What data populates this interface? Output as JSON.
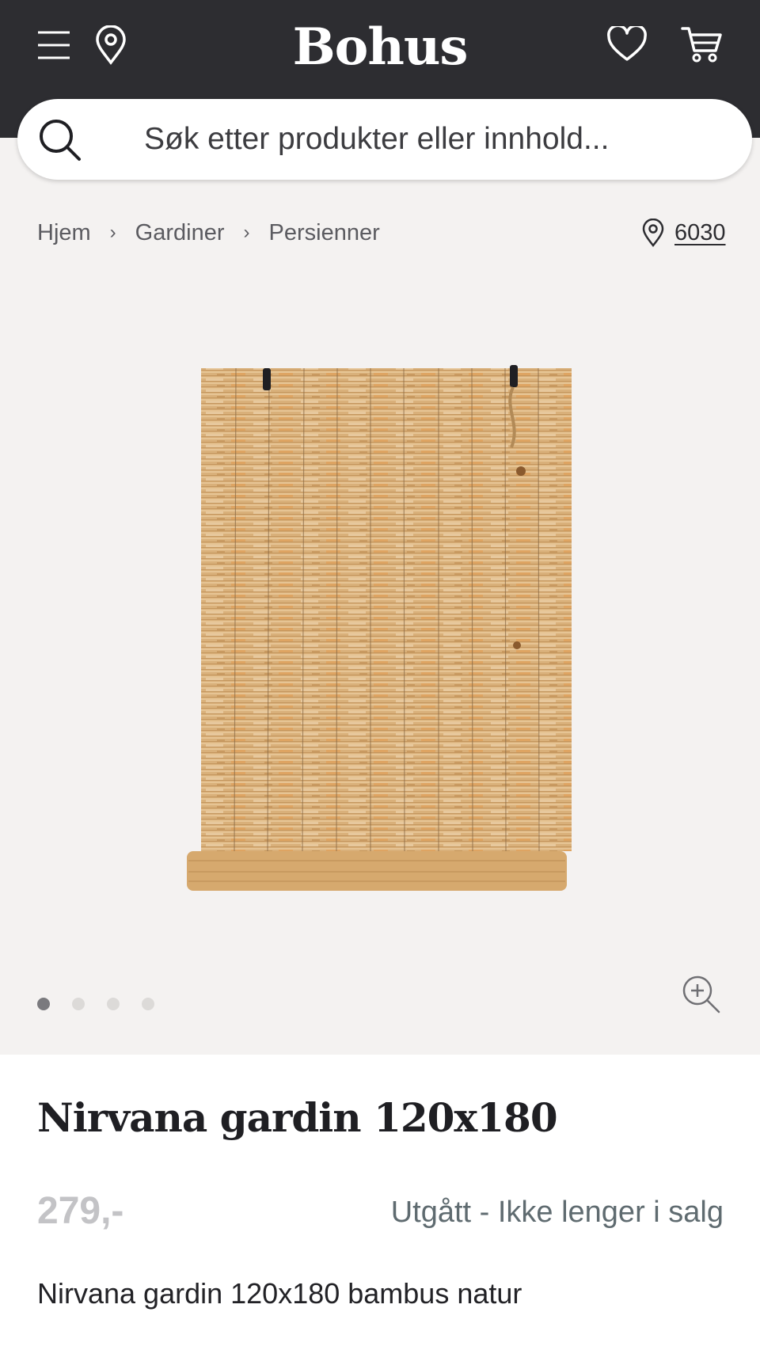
{
  "header": {
    "logo": "Bohus",
    "icons": [
      "menu-icon",
      "location-pin-icon",
      "heart-icon",
      "cart-icon"
    ],
    "background_color": "#2d2d31"
  },
  "search": {
    "placeholder": "Søk etter produkter eller innhold..."
  },
  "breadcrumb": {
    "items": [
      "Hjem",
      "Gardiner",
      "Persienner"
    ],
    "separator": "›"
  },
  "postcode": {
    "value": "6030"
  },
  "gallery": {
    "image_count": 4,
    "active_index": 0
  },
  "product": {
    "title": "Nirvana gardin 120x180",
    "price": "279,-",
    "status": "Utgått - Ikke lenger i salg",
    "description": "Nirvana gardin 120x180 bambus natur"
  },
  "colors": {
    "page_background": "#f4f2f1",
    "status_text": "#5f6b70",
    "price_text": "#c3c3c6"
  }
}
